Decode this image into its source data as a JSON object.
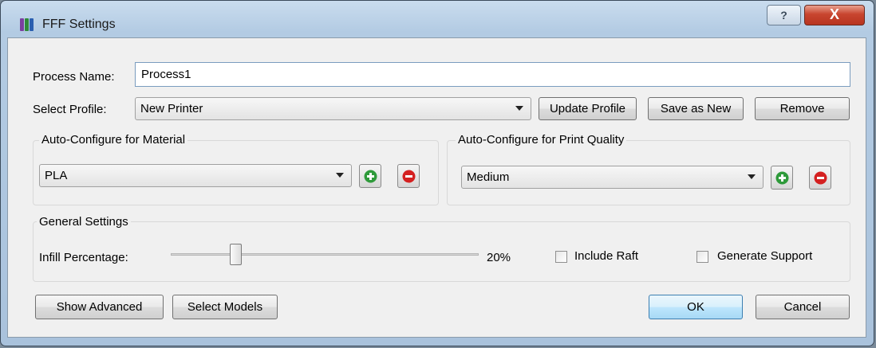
{
  "window": {
    "title": "FFF Settings",
    "help_glyph": "?",
    "close_glyph": "X"
  },
  "colors": {
    "add_green": "#2e9a3a",
    "remove_red": "#d42020",
    "accent": "#3c7fb1"
  },
  "process_name": {
    "label": "Process Name:",
    "value": "Process1"
  },
  "profile": {
    "label": "Select Profile:",
    "selected": "New Printer",
    "update_label": "Update Profile",
    "save_new_label": "Save as New",
    "remove_label": "Remove"
  },
  "material": {
    "group_label": "Auto-Configure for Material",
    "selected": "PLA",
    "add_icon": "add-icon",
    "remove_icon": "remove-icon"
  },
  "quality": {
    "group_label": "Auto-Configure for Print Quality",
    "selected": "Medium",
    "add_icon": "add-icon",
    "remove_icon": "remove-icon"
  },
  "general": {
    "group_label": "General Settings",
    "infill_label": "Infill Percentage:",
    "infill_value": "20%",
    "infill_percent": 20,
    "raft_label": "Include Raft",
    "raft_checked": false,
    "support_label": "Generate Support",
    "support_checked": false
  },
  "footer": {
    "show_advanced_label": "Show Advanced",
    "select_models_label": "Select Models",
    "ok_label": "OK",
    "cancel_label": "Cancel"
  }
}
